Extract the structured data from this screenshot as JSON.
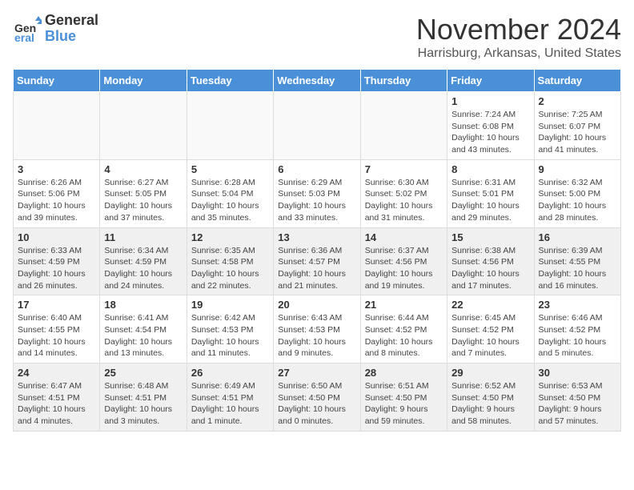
{
  "logo": {
    "general": "General",
    "blue": "Blue"
  },
  "title": "November 2024",
  "location": "Harrisburg, Arkansas, United States",
  "weekdays": [
    "Sunday",
    "Monday",
    "Tuesday",
    "Wednesday",
    "Thursday",
    "Friday",
    "Saturday"
  ],
  "weeks": [
    {
      "shaded": false,
      "days": [
        {
          "num": "",
          "info": ""
        },
        {
          "num": "",
          "info": ""
        },
        {
          "num": "",
          "info": ""
        },
        {
          "num": "",
          "info": ""
        },
        {
          "num": "",
          "info": ""
        },
        {
          "num": "1",
          "info": "Sunrise: 7:24 AM\nSunset: 6:08 PM\nDaylight: 10 hours and 43 minutes."
        },
        {
          "num": "2",
          "info": "Sunrise: 7:25 AM\nSunset: 6:07 PM\nDaylight: 10 hours and 41 minutes."
        }
      ]
    },
    {
      "shaded": false,
      "days": [
        {
          "num": "3",
          "info": "Sunrise: 6:26 AM\nSunset: 5:06 PM\nDaylight: 10 hours and 39 minutes."
        },
        {
          "num": "4",
          "info": "Sunrise: 6:27 AM\nSunset: 5:05 PM\nDaylight: 10 hours and 37 minutes."
        },
        {
          "num": "5",
          "info": "Sunrise: 6:28 AM\nSunset: 5:04 PM\nDaylight: 10 hours and 35 minutes."
        },
        {
          "num": "6",
          "info": "Sunrise: 6:29 AM\nSunset: 5:03 PM\nDaylight: 10 hours and 33 minutes."
        },
        {
          "num": "7",
          "info": "Sunrise: 6:30 AM\nSunset: 5:02 PM\nDaylight: 10 hours and 31 minutes."
        },
        {
          "num": "8",
          "info": "Sunrise: 6:31 AM\nSunset: 5:01 PM\nDaylight: 10 hours and 29 minutes."
        },
        {
          "num": "9",
          "info": "Sunrise: 6:32 AM\nSunset: 5:00 PM\nDaylight: 10 hours and 28 minutes."
        }
      ]
    },
    {
      "shaded": true,
      "days": [
        {
          "num": "10",
          "info": "Sunrise: 6:33 AM\nSunset: 4:59 PM\nDaylight: 10 hours and 26 minutes."
        },
        {
          "num": "11",
          "info": "Sunrise: 6:34 AM\nSunset: 4:59 PM\nDaylight: 10 hours and 24 minutes."
        },
        {
          "num": "12",
          "info": "Sunrise: 6:35 AM\nSunset: 4:58 PM\nDaylight: 10 hours and 22 minutes."
        },
        {
          "num": "13",
          "info": "Sunrise: 6:36 AM\nSunset: 4:57 PM\nDaylight: 10 hours and 21 minutes."
        },
        {
          "num": "14",
          "info": "Sunrise: 6:37 AM\nSunset: 4:56 PM\nDaylight: 10 hours and 19 minutes."
        },
        {
          "num": "15",
          "info": "Sunrise: 6:38 AM\nSunset: 4:56 PM\nDaylight: 10 hours and 17 minutes."
        },
        {
          "num": "16",
          "info": "Sunrise: 6:39 AM\nSunset: 4:55 PM\nDaylight: 10 hours and 16 minutes."
        }
      ]
    },
    {
      "shaded": false,
      "days": [
        {
          "num": "17",
          "info": "Sunrise: 6:40 AM\nSunset: 4:55 PM\nDaylight: 10 hours and 14 minutes."
        },
        {
          "num": "18",
          "info": "Sunrise: 6:41 AM\nSunset: 4:54 PM\nDaylight: 10 hours and 13 minutes."
        },
        {
          "num": "19",
          "info": "Sunrise: 6:42 AM\nSunset: 4:53 PM\nDaylight: 10 hours and 11 minutes."
        },
        {
          "num": "20",
          "info": "Sunrise: 6:43 AM\nSunset: 4:53 PM\nDaylight: 10 hours and 9 minutes."
        },
        {
          "num": "21",
          "info": "Sunrise: 6:44 AM\nSunset: 4:52 PM\nDaylight: 10 hours and 8 minutes."
        },
        {
          "num": "22",
          "info": "Sunrise: 6:45 AM\nSunset: 4:52 PM\nDaylight: 10 hours and 7 minutes."
        },
        {
          "num": "23",
          "info": "Sunrise: 6:46 AM\nSunset: 4:52 PM\nDaylight: 10 hours and 5 minutes."
        }
      ]
    },
    {
      "shaded": true,
      "days": [
        {
          "num": "24",
          "info": "Sunrise: 6:47 AM\nSunset: 4:51 PM\nDaylight: 10 hours and 4 minutes."
        },
        {
          "num": "25",
          "info": "Sunrise: 6:48 AM\nSunset: 4:51 PM\nDaylight: 10 hours and 3 minutes."
        },
        {
          "num": "26",
          "info": "Sunrise: 6:49 AM\nSunset: 4:51 PM\nDaylight: 10 hours and 1 minute."
        },
        {
          "num": "27",
          "info": "Sunrise: 6:50 AM\nSunset: 4:50 PM\nDaylight: 10 hours and 0 minutes."
        },
        {
          "num": "28",
          "info": "Sunrise: 6:51 AM\nSunset: 4:50 PM\nDaylight: 9 hours and 59 minutes."
        },
        {
          "num": "29",
          "info": "Sunrise: 6:52 AM\nSunset: 4:50 PM\nDaylight: 9 hours and 58 minutes."
        },
        {
          "num": "30",
          "info": "Sunrise: 6:53 AM\nSunset: 4:50 PM\nDaylight: 9 hours and 57 minutes."
        }
      ]
    }
  ]
}
